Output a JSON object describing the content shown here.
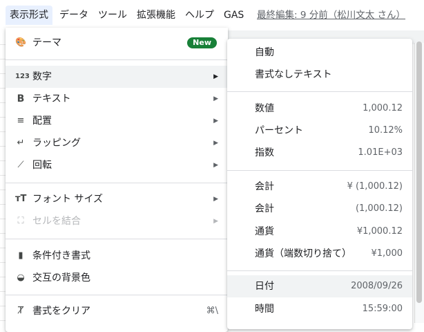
{
  "menubar": {
    "items": [
      "表示形式",
      "データ",
      "ツール",
      "拡張機能",
      "ヘルプ",
      "GAS"
    ],
    "last_edit": "最終編集: 9 分前（松川文太 さん）"
  },
  "format_menu": {
    "theme": {
      "label": "テーマ",
      "icon": "palette-icon",
      "badge": "New"
    },
    "number": {
      "label": "数字",
      "icon": "number-123-icon"
    },
    "text": {
      "label": "テキスト",
      "icon": "bold-icon"
    },
    "align": {
      "label": "配置",
      "icon": "align-left-icon"
    },
    "wrap": {
      "label": "ラッピング",
      "icon": "wrap-icon"
    },
    "rotate": {
      "label": "回転",
      "icon": "rotate-icon"
    },
    "font_size": {
      "label": "フォント サイズ",
      "icon": "font-size-icon"
    },
    "merge": {
      "label": "セルを結合",
      "icon": "merge-icon"
    },
    "cond_format": {
      "label": "条件付き書式",
      "icon": "paint-roller-icon"
    },
    "alt_colors": {
      "label": "交互の背景色",
      "icon": "fill-drop-icon"
    },
    "clear": {
      "label": "書式をクリア",
      "icon": "clear-format-icon",
      "shortcut": "⌘\\"
    }
  },
  "number_submenu": [
    {
      "label": "自動",
      "value": ""
    },
    {
      "label": "書式なしテキスト",
      "value": ""
    },
    {
      "label": "数値",
      "value": "1,000.12"
    },
    {
      "label": "パーセント",
      "value": "10.12%"
    },
    {
      "label": "指数",
      "value": "1.01E+03"
    },
    {
      "label": "会計",
      "value": "¥ (1,000.12)"
    },
    {
      "label": "会計",
      "value": "(1,000.12)"
    },
    {
      "label": "通貨",
      "value": "¥1,000.12"
    },
    {
      "label": "通貨（端数切り捨て）",
      "value": "¥1,000"
    },
    {
      "label": "日付",
      "value": "2008/09/26"
    },
    {
      "label": "時間",
      "value": "15:59:00"
    }
  ]
}
